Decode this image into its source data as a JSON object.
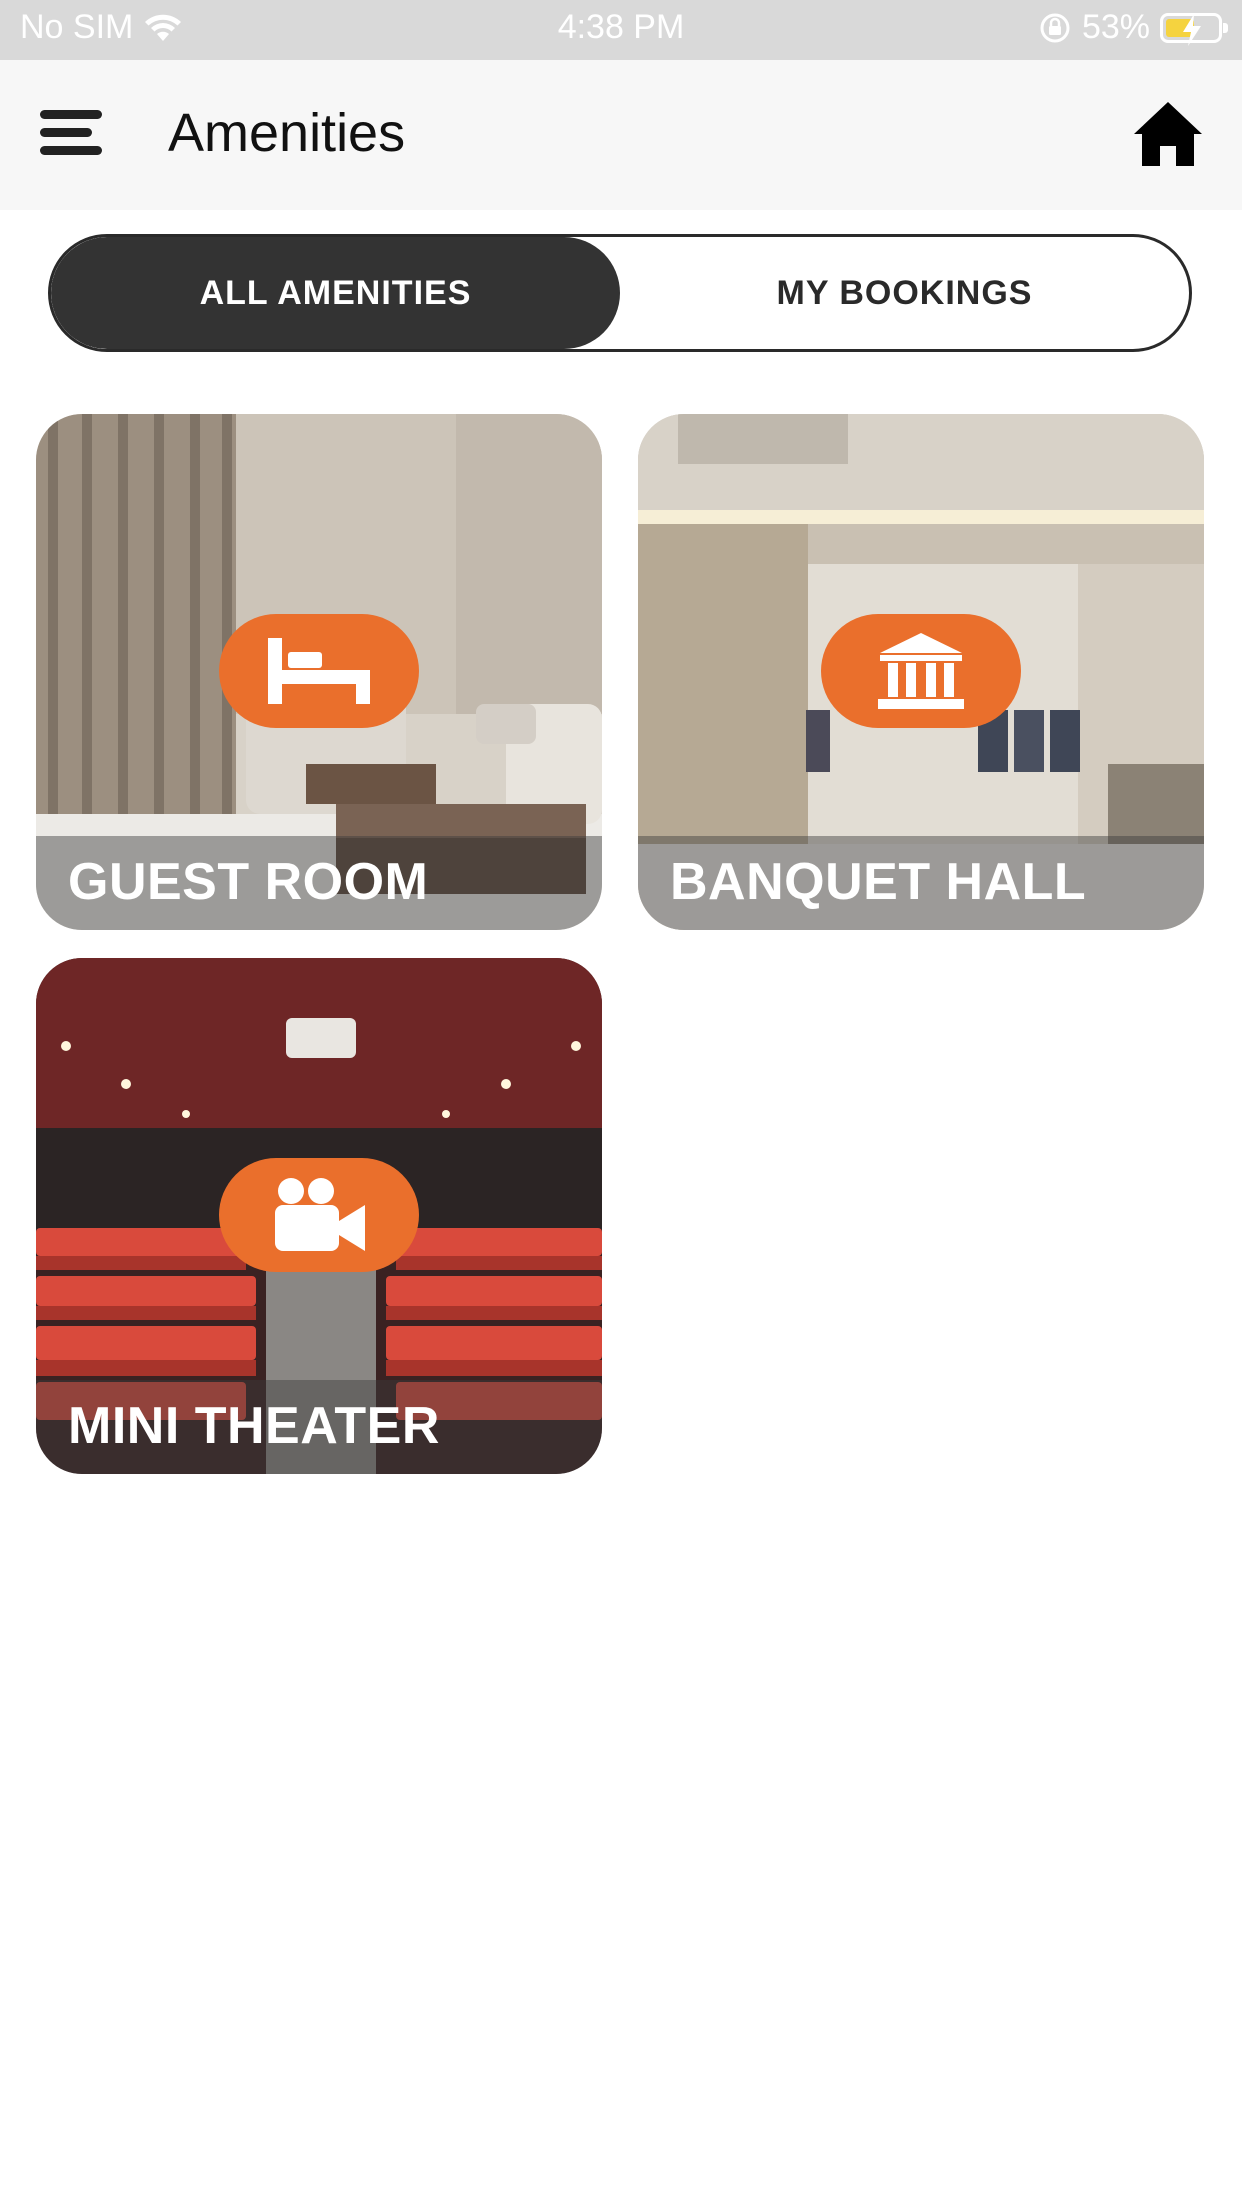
{
  "status_bar": {
    "carrier": "No SIM",
    "time": "4:38 PM",
    "battery_percent": "53%",
    "battery_level": 0.53
  },
  "header": {
    "title": "Amenities",
    "menu_icon": "hamburger-menu-icon",
    "home_icon": "home-icon"
  },
  "tabs": [
    {
      "label": "ALL AMENITIES",
      "active": true
    },
    {
      "label": "MY BOOKINGS",
      "active": false
    }
  ],
  "amenities": [
    {
      "label": "GUEST ROOM",
      "icon": "bed-icon",
      "badge_color": "#ea6f2c"
    },
    {
      "label": "BANQUET HALL",
      "icon": "institution-icon",
      "badge_color": "#ea6f2c"
    },
    {
      "label": "MINI THEATER",
      "icon": "video-camera-icon",
      "badge_color": "#ea6f2c"
    }
  ],
  "colors": {
    "accent": "#ea6f2c",
    "active_tab": "#333333",
    "header_bg": "#f7f7f7",
    "status_bar_bg": "#d9d9d9"
  }
}
